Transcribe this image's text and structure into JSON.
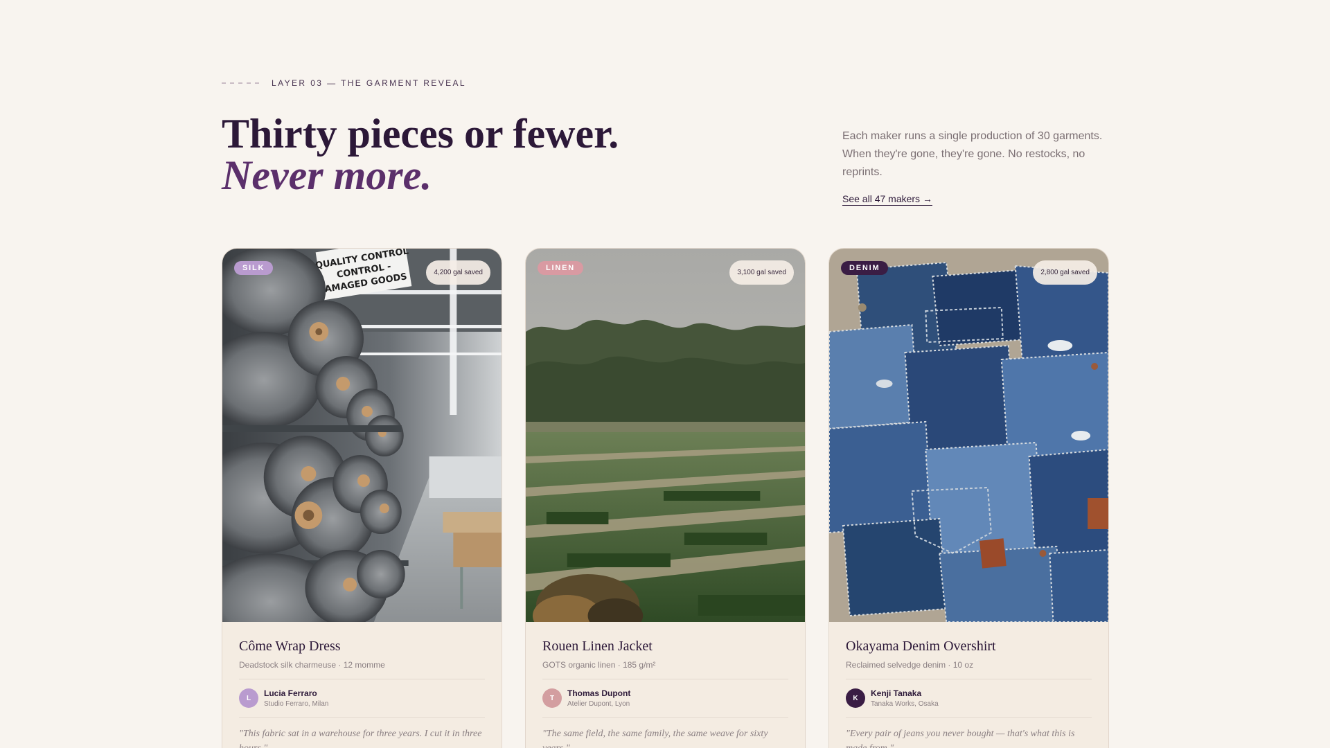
{
  "header": {
    "eyebrow": "LAYER 03 — THE GARMENT REVEAL",
    "headline_line1": "Thirty pieces or fewer.",
    "headline_line2": "Never more.",
    "description": "Each maker runs a single production of 30 garments. When they're gone, they're gone. No restocks, no reprints.",
    "cta": "See all 47 makers →"
  },
  "photo_sign": [
    "QUALITY CONTROL",
    "CONTROL -",
    "AMAGED GOODS"
  ],
  "cards": [
    {
      "tag": "SILK",
      "tag_color": "#b99bcf",
      "saved": "4,200 gal saved",
      "title": "Côme Wrap Dress",
      "fabric": "Deadstock silk charmeuse · 12 momme",
      "maker_initial": "L",
      "avatar_color": "#b99bcf",
      "maker_name": "Lucia Ferraro",
      "maker_studio": "Studio Ferraro, Milan",
      "quote": "\"This fabric sat in a warehouse for three years. I cut it in three hours.\""
    },
    {
      "tag": "LINEN",
      "tag_color": "#d99aa2",
      "saved": "3,100 gal saved",
      "title": "Rouen Linen Jacket",
      "fabric": "GOTS organic linen · 185 g/m²",
      "maker_initial": "T",
      "avatar_color": "#d39ea0",
      "maker_name": "Thomas Dupont",
      "maker_studio": "Atelier Dupont, Lyon",
      "quote": "\"The same field, the same family, the same weave for sixty years.\""
    },
    {
      "tag": "DENIM",
      "tag_color": "#3a1d44",
      "saved": "2,800 gal saved",
      "title": "Okayama Denim Overshirt",
      "fabric": "Reclaimed selvedge denim · 10 oz",
      "maker_initial": "K",
      "avatar_color": "#3a1d44",
      "maker_name": "Kenji Tanaka",
      "maker_studio": "Tanaka Works, Osaka",
      "quote": "\"Every pair of jeans you never bought — that's what this is made from.\""
    }
  ]
}
